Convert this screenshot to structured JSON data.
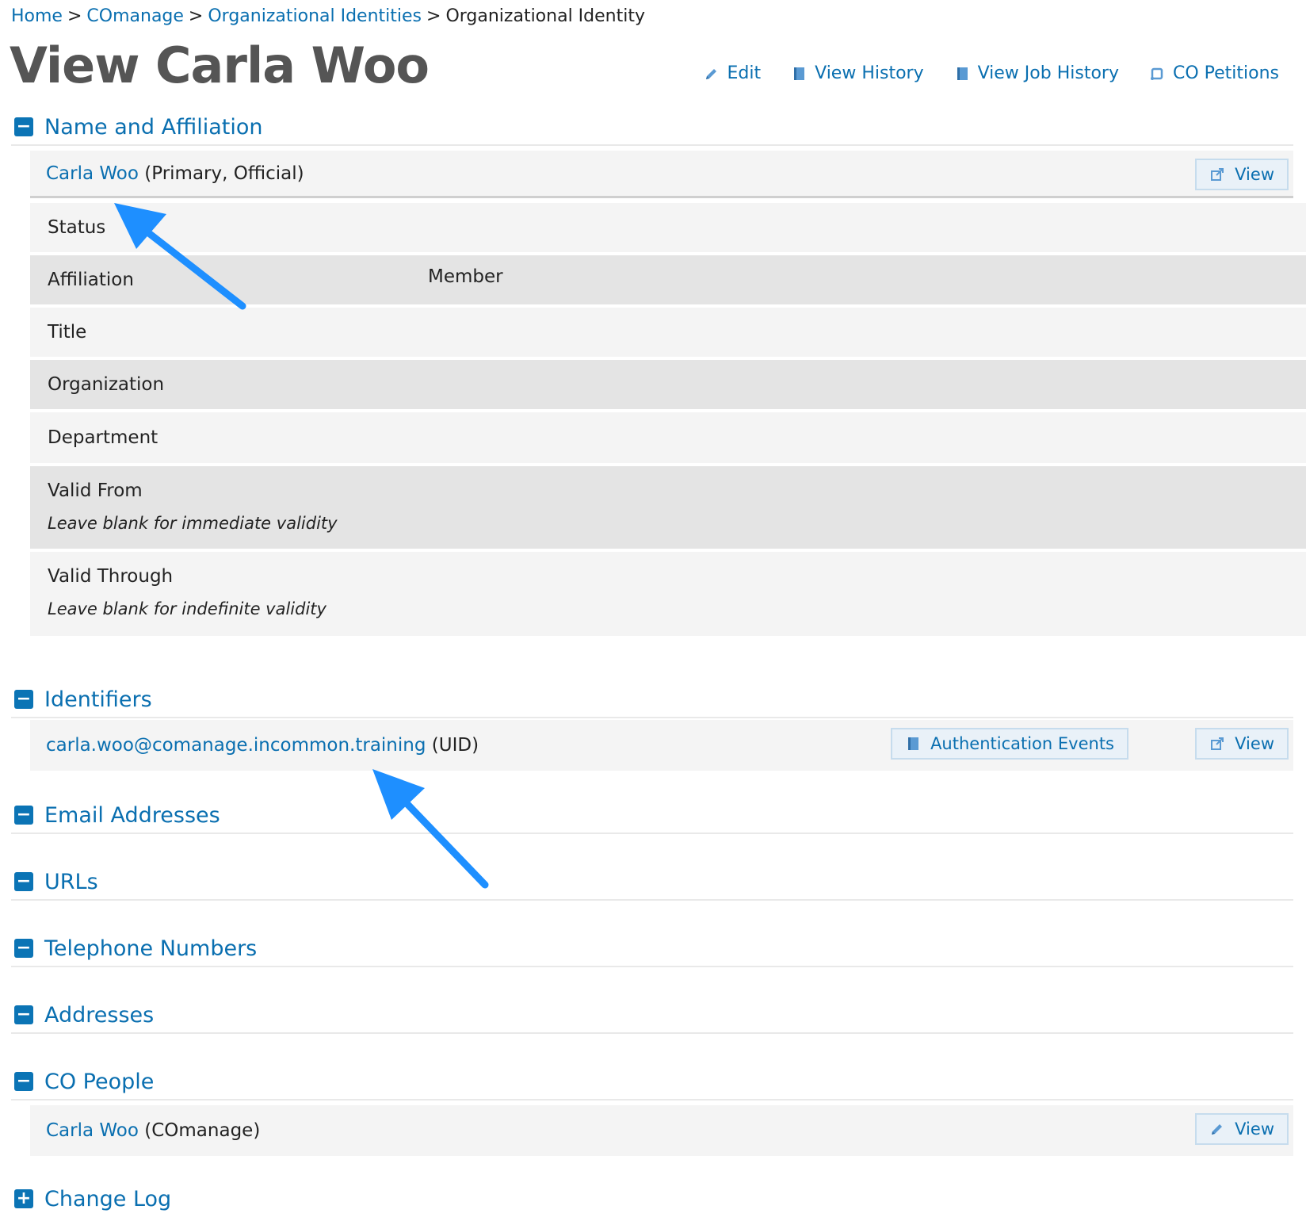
{
  "breadcrumb": {
    "home": "Home",
    "comanage": "COmanage",
    "org_identities": "Organizational Identities",
    "current": "Organizational Identity",
    "separator": ">"
  },
  "page": {
    "title": "View Carla Woo"
  },
  "top_actions": {
    "edit": "Edit",
    "view_history": "View History",
    "view_job_history": "View Job History",
    "co_petitions": "CO Petitions"
  },
  "name_affiliation": {
    "title": "Name and Affiliation",
    "name_link": "Carla Woo",
    "name_suffix": " (Primary, Official)",
    "view_button": "View",
    "fields": {
      "status": {
        "label": "Status",
        "value": ""
      },
      "affiliation": {
        "label": "Affiliation",
        "value": "Member"
      },
      "title": {
        "label": "Title",
        "value": ""
      },
      "organization": {
        "label": "Organization",
        "value": ""
      },
      "department": {
        "label": "Department",
        "value": ""
      },
      "valid_from": {
        "label": "Valid From",
        "hint": "Leave blank for immediate validity"
      },
      "valid_through": {
        "label": "Valid Through",
        "hint": "Leave blank for indefinite validity"
      }
    }
  },
  "identifiers": {
    "title": "Identifiers",
    "id_link": "carla.woo@comanage.incommon.training",
    "id_suffix": " (UID)",
    "auth_events_button": "Authentication Events",
    "view_button": "View"
  },
  "sections": {
    "email": "Email Addresses",
    "urls": "URLs",
    "telephone": "Telephone Numbers",
    "addresses": "Addresses",
    "co_people": "CO People",
    "change_log": "Change Log"
  },
  "co_people": {
    "person_link": "Carla Woo",
    "person_suffix": " (COmanage)",
    "view_button": "View"
  },
  "toggles": {
    "collapse": "−",
    "expand": "+"
  },
  "colors": {
    "accent": "#0a6fb0",
    "toggle": "#0b74b5",
    "arrow": "#1e8fff"
  }
}
